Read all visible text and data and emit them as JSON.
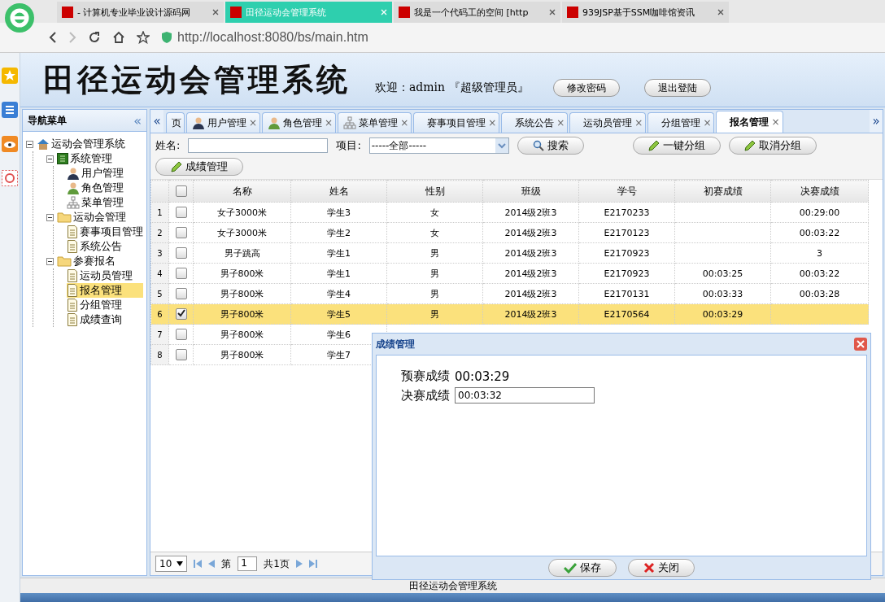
{
  "browser": {
    "tabs": [
      {
        "title": "- 计算机专业毕业设计源码网",
        "selected": false
      },
      {
        "title": "田径运动会管理系统",
        "selected": true
      },
      {
        "title": "我是一个代码工的空间 [http",
        "selected": false
      },
      {
        "title": "939JSP基于SSM咖啡馆资讯",
        "selected": false
      }
    ],
    "url": "http://localhost:8080/bs/main.htm"
  },
  "header": {
    "title": "田径运动会管理系统",
    "welcome": "欢迎：admin 『超级管理员』",
    "buttons": [
      "修改密码",
      "退出登陆"
    ]
  },
  "nav": {
    "title": "导航菜单",
    "collapse": "«",
    "tree": [
      {
        "label": "运动会管理系统",
        "kind": "home",
        "expanded": true,
        "selected": false,
        "children": [
          {
            "label": "系统管理",
            "kind": "system",
            "expanded": true,
            "selected": false,
            "children": [
              {
                "label": "用户管理",
                "kind": "user",
                "selected": false
              },
              {
                "label": "角色管理",
                "kind": "role",
                "selected": false
              },
              {
                "label": "菜单管理",
                "kind": "menu",
                "selected": false
              }
            ]
          },
          {
            "label": "运动会管理",
            "kind": "folder",
            "expanded": true,
            "selected": false,
            "children": [
              {
                "label": "赛事项目管理",
                "kind": "page",
                "selected": false
              },
              {
                "label": "系统公告",
                "kind": "page",
                "selected": false
              }
            ]
          },
          {
            "label": "参赛报名",
            "kind": "folder",
            "expanded": true,
            "selected": false,
            "children": [
              {
                "label": "运动员管理",
                "kind": "page",
                "selected": false
              },
              {
                "label": "报名管理",
                "kind": "page",
                "selected": true
              },
              {
                "label": "分组管理",
                "kind": "page",
                "selected": false
              },
              {
                "label": "成绩查询",
                "kind": "page",
                "selected": false
              }
            ]
          }
        ]
      }
    ]
  },
  "tabs": {
    "prev": "«",
    "next": "»",
    "items": [
      {
        "label": "页",
        "kind": "none",
        "selected": false
      },
      {
        "label": "用户管理",
        "kind": "user",
        "selected": false
      },
      {
        "label": "角色管理",
        "kind": "role",
        "selected": false
      },
      {
        "label": "菜单管理",
        "kind": "menu",
        "selected": false
      },
      {
        "label": "赛事项目管理",
        "kind": "none",
        "selected": false
      },
      {
        "label": "系统公告",
        "kind": "none",
        "selected": false
      },
      {
        "label": "运动员管理",
        "kind": "none",
        "selected": false
      },
      {
        "label": "分组管理",
        "kind": "none",
        "selected": false
      },
      {
        "label": "报名管理",
        "kind": "none",
        "selected": true
      }
    ],
    "close": "×"
  },
  "toolbar": {
    "name_label": "姓名:",
    "project_label": "项目:",
    "project_value": "-----全部-----",
    "buttons": [
      {
        "label": "搜索",
        "kind": "search"
      },
      {
        "label": "一键分组",
        "kind": "edit"
      },
      {
        "label": "取消分组",
        "kind": "edit"
      },
      {
        "label": "成绩管理",
        "kind": "edit"
      }
    ]
  },
  "table": {
    "all_checked": false,
    "columns": [
      "名称",
      "姓名",
      "性别",
      "班级",
      "学号",
      "初赛成绩",
      "决赛成绩"
    ],
    "rows": [
      {
        "num": "1",
        "checked": false,
        "selected": false,
        "cells": [
          "女子3000米",
          "学生3",
          "女",
          "2014级2班3",
          "E2170233",
          "",
          "00:29:00"
        ]
      },
      {
        "num": "2",
        "checked": false,
        "selected": false,
        "cells": [
          "女子3000米",
          "学生2",
          "女",
          "2014级2班3",
          "E2170123",
          "",
          "00:03:22"
        ]
      },
      {
        "num": "3",
        "checked": false,
        "selected": false,
        "cells": [
          "男子跳高",
          "学生1",
          "男",
          "2014级2班3",
          "E2170923",
          "",
          "3"
        ]
      },
      {
        "num": "4",
        "checked": false,
        "selected": false,
        "cells": [
          "男子800米",
          "学生1",
          "男",
          "2014级2班3",
          "E2170923",
          "00:03:25",
          "00:03:22"
        ]
      },
      {
        "num": "5",
        "checked": false,
        "selected": false,
        "cells": [
          "男子800米",
          "学生4",
          "男",
          "2014级2班3",
          "E2170131",
          "00:03:33",
          "00:03:28"
        ]
      },
      {
        "num": "6",
        "checked": true,
        "selected": true,
        "cells": [
          "男子800米",
          "学生5",
          "男",
          "2014级2班3",
          "E2170564",
          "00:03:29",
          ""
        ]
      },
      {
        "num": "7",
        "checked": false,
        "selected": false,
        "cells": [
          "男子800米",
          "学生6"
        ]
      },
      {
        "num": "8",
        "checked": false,
        "selected": false,
        "cells": [
          "男子800米",
          "学生7"
        ]
      }
    ]
  },
  "pager": {
    "page_size": "10",
    "page_prefix": "第",
    "page": "1",
    "total": "共1页"
  },
  "dialog": {
    "title": "成绩管理",
    "fields": [
      {
        "label": "预赛成绩",
        "value": "00:03:29",
        "kind": "text"
      },
      {
        "label": "决赛成绩",
        "value": "00:03:32",
        "kind": "input"
      }
    ],
    "buttons": [
      {
        "label": "保存",
        "kind": "ok"
      },
      {
        "label": "关闭",
        "kind": "cancel"
      }
    ]
  },
  "status_bar": "田径运动会管理系统"
}
